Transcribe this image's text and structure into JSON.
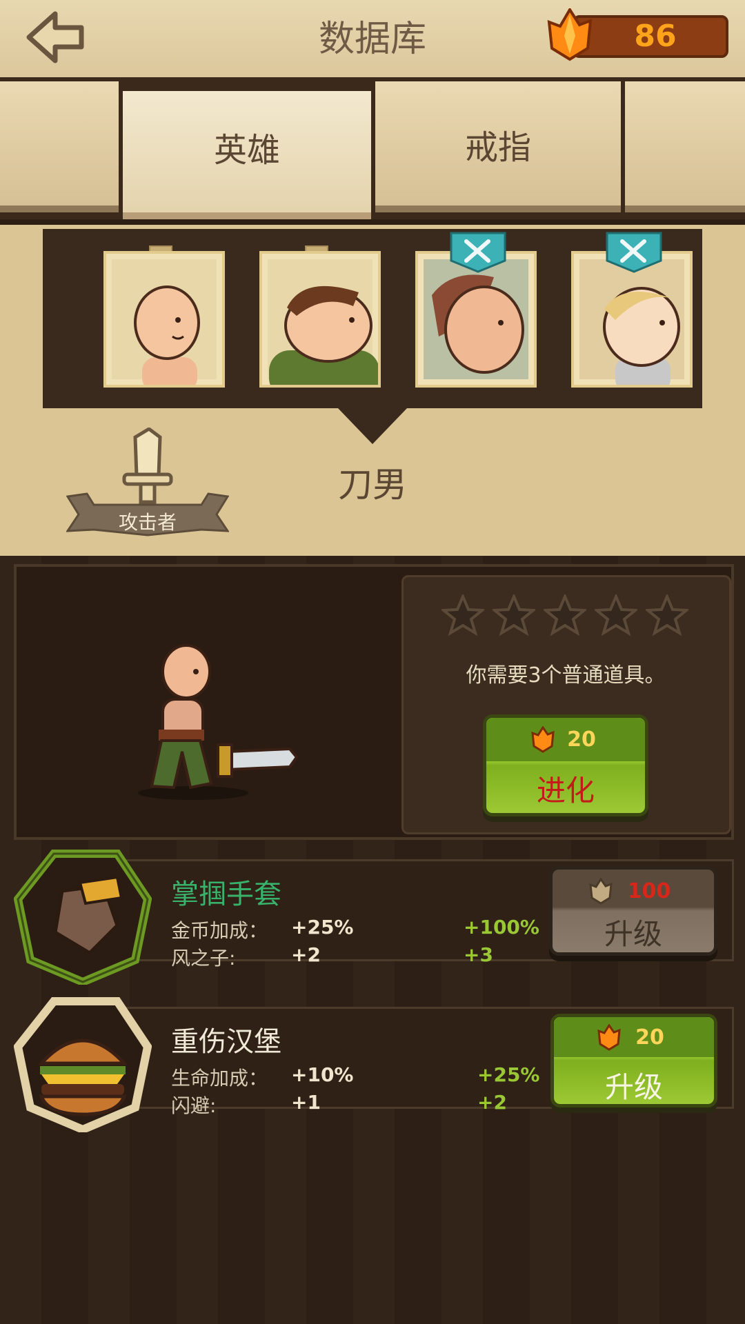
{
  "header": {
    "title": "数据库",
    "gem_count": "86"
  },
  "tabs": [
    {
      "label": ""
    },
    {
      "label": "英雄",
      "active": true
    },
    {
      "label": "戒指"
    },
    {
      "label": ""
    }
  ],
  "hero": {
    "name": "刀男",
    "class_label": "攻击者",
    "portraits": [
      {
        "icon": "bald-boy-portrait"
      },
      {
        "icon": "brute-portrait"
      },
      {
        "icon": "brown-hair-hero-portrait",
        "badge": "crossed-swords-icon"
      },
      {
        "icon": "blonde-hero-portrait",
        "badge": "crossed-swords-icon"
      }
    ]
  },
  "evolve": {
    "stars_filled": 0,
    "stars_total": 5,
    "hint": "你需要3个普通道具。",
    "cost": "20",
    "button_label": "进化"
  },
  "items": [
    {
      "name": "掌掴手套",
      "name_color": "#39b36b",
      "stats": [
        {
          "label": "金币加成：",
          "value": "+25%",
          "next": "+100%"
        },
        {
          "label": "风之子:",
          "value": "+2",
          "next": "+3"
        }
      ],
      "cost": "100",
      "button_label": "升级",
      "button_enabled": false
    },
    {
      "name": "重伤汉堡",
      "name_color": "#f2ead8",
      "stats": [
        {
          "label": "生命加成：",
          "value": "+10%",
          "next": "+25%"
        },
        {
          "label": "闪避:",
          "value": "+1",
          "next": "+2"
        }
      ],
      "cost": "20",
      "button_label": "升级",
      "button_enabled": true
    }
  ],
  "colors": {
    "gem_orange": "#ffa31a",
    "cost_red": "#d8261a",
    "evolve_red": "#c41a1a",
    "upgrade_green": "#9bcc30"
  }
}
